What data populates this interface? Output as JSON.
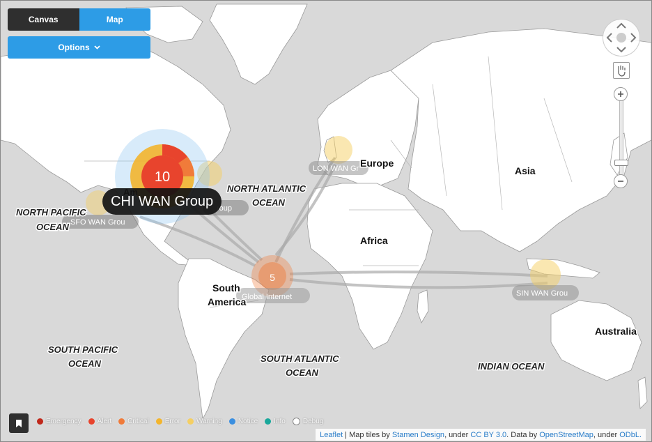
{
  "tabs": {
    "canvas": "Canvas",
    "map": "Map"
  },
  "options_button": {
    "label": "Options",
    "icon": "chevron-down-icon"
  },
  "map": {
    "continents": [
      "Europe",
      "Asia",
      "Africa",
      "South",
      "America",
      "Australia"
    ],
    "oceans": {
      "north_atlantic": [
        "NORTH ATLANTIC",
        "OCEAN"
      ],
      "north_pacific": [
        "NORTH PACIFIC",
        "OCEAN"
      ],
      "south_pacific": [
        "SOUTH PACIFIC",
        "OCEAN"
      ],
      "south_atlantic": [
        "SOUTH ATLANTIC",
        "OCEAN"
      ],
      "indian": "INDIAN OCEAN"
    },
    "nodes": {
      "chi": {
        "count": "10",
        "label": "Am"
      },
      "global": {
        "count": "5",
        "label": "Global Internet"
      },
      "lon": {
        "label": "LON WAN Gr"
      },
      "sfo": {
        "label": "SFO WAN Grou"
      },
      "ny": {
        "label": "roup"
      },
      "sin": {
        "label": "SIN WAN Grou"
      }
    }
  },
  "tooltip": {
    "text": "CHI WAN Group"
  },
  "legend": [
    {
      "label": "Emergency",
      "color": "#c0281b"
    },
    {
      "label": "Alert",
      "color": "#e8442d"
    },
    {
      "label": "Critical",
      "color": "#f07b3a"
    },
    {
      "label": "Error",
      "color": "#f3b52d"
    },
    {
      "label": "Warning",
      "color": "#f5cf63"
    },
    {
      "label": "Notice",
      "color": "#3b8fe0"
    },
    {
      "label": "Info",
      "color": "#1aa89b"
    },
    {
      "label": "Debug",
      "color": "#ffffff"
    }
  ],
  "attribution": {
    "leaflet": "Leaflet",
    "sep1": " | Map tiles by ",
    "stamen": "Stamen Design",
    "sep2": ", under ",
    "ccby": "CC BY 3.0",
    "sep3": ". Data by ",
    "osm": "OpenStreetMap",
    "sep4": ", under ",
    "odbl": "ODbL."
  },
  "icons": {
    "pan": "pan-arrows-icon",
    "hand": "hand-icon",
    "bookmark": "bookmark-icon"
  }
}
